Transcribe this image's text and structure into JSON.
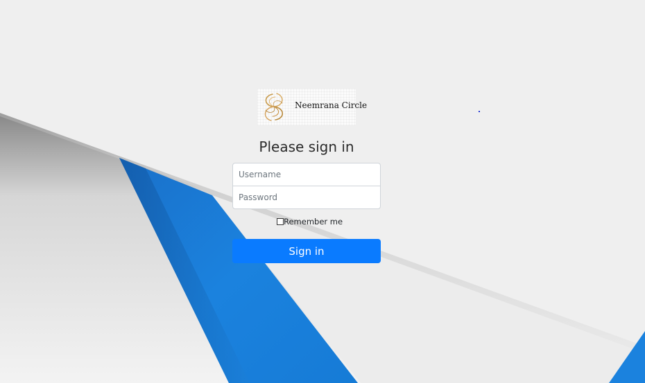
{
  "logo": {
    "text": "Neemrana Circle"
  },
  "form": {
    "heading": "Please sign in",
    "username_placeholder": "Username",
    "password_placeholder": "Password",
    "remember_label": "Remember me",
    "remember_checked": false,
    "submit_label": "Sign in"
  },
  "colors": {
    "background": "#efefef",
    "accent_blue": "#0a7bff",
    "stripe_blue": "#1a7fd8"
  }
}
